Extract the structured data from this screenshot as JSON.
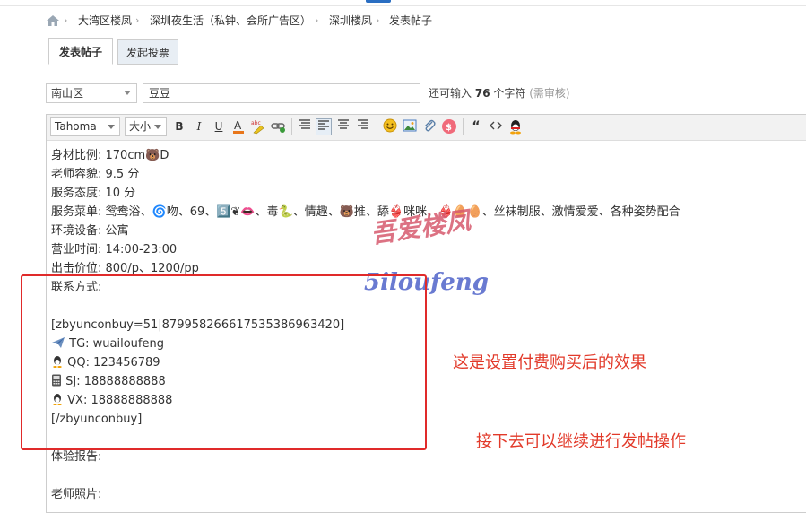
{
  "breadcrumb": {
    "items": [
      "大湾区楼凤",
      "深圳夜生活（私钟、会所广告区）",
      "深圳楼凤",
      "发表帖子"
    ],
    "separator": "›"
  },
  "tabs": [
    {
      "label": "发表帖子",
      "active": true
    },
    {
      "label": "发起投票",
      "active": false
    }
  ],
  "form": {
    "category": "南山区",
    "title": "豆豆",
    "remain_prefix": "还可输入",
    "remain_count": "76",
    "remain_suffix": "个字符",
    "remain_note": "(需审核)"
  },
  "toolbar": {
    "font": "Tahoma",
    "size": "大小",
    "bold": "B",
    "italic": "I",
    "underline": "U",
    "quote": "“"
  },
  "content": {
    "body_lines": [
      "身材比例:  170cm🐻D",
      "老师容貌:   9.5 分",
      "服务态度:   10 分",
      "服务菜单:   鸳鸯浴、🌀吻、69、5️⃣❦👄、毒🐍、情趣、🐻推、舔👙咪咪、👙🥚🥚、丝袜制服、激情爱爱、各种姿势配合",
      "环境设备:   公寓",
      "营业时间:  14:00-23:00",
      "出击价位:   800/p、1200/pp",
      "联系方式:"
    ],
    "buy_open": "[zbyunconbuy=51|879958266617535386963420]",
    "contacts": [
      {
        "icon": "plane",
        "text": "TG:  wuailoufeng"
      },
      {
        "icon": "penguin",
        "text": "QQ: 123456789"
      },
      {
        "icon": "phone",
        "text": "SJ: 18888888888"
      },
      {
        "icon": "penguin",
        "text": "VX: 18888888888"
      }
    ],
    "buy_close": "[/zbyunconbuy]",
    "report_label": "体验报告:",
    "photos_label": "老师照片:"
  },
  "annotations": {
    "note1": "这是设置付费购买后的效果",
    "note2": "接下去可以继续进行发帖操作",
    "watermark_cn": "吾爱楼凤",
    "watermark_en": "5iloufeng"
  },
  "colors": {
    "annotation_red": "#e23a2a",
    "tab_inactive_bg": "#e8eef4"
  }
}
